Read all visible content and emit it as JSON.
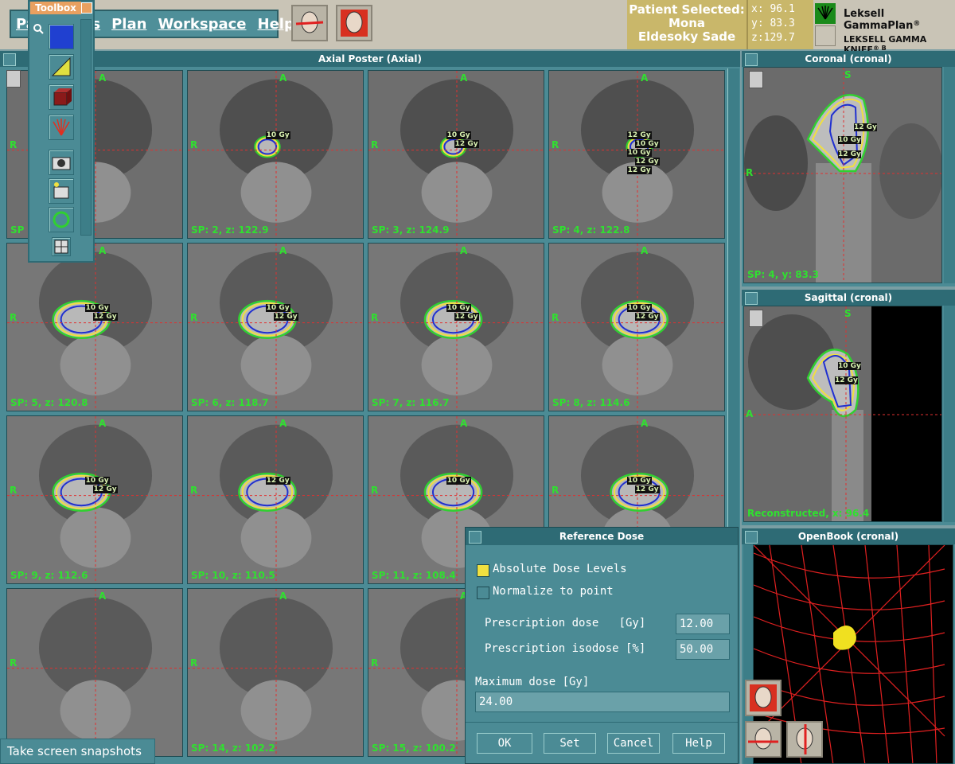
{
  "menu": {
    "items": [
      "Pa",
      "ols",
      "Plan",
      "Workspace",
      "Help"
    ]
  },
  "toolbox": {
    "title": "Toolbox"
  },
  "patient": {
    "label": "Patient Selected:",
    "name1": "Mona",
    "name2": "Eldesoky Sade"
  },
  "coords": {
    "x": "x:  96.1",
    "y": "y:  83.3",
    "z": "z:129.7"
  },
  "brand": {
    "line1": "Leksell GammaPlan",
    "line1_mark": "®",
    "line2": "LEKSELL GAMMA KNIFE",
    "line2_mark": "® B"
  },
  "axial": {
    "title": "Axial Poster (Axial)",
    "orient_a": "A",
    "orient_r": "R",
    "slices": [
      {
        "label": "SP",
        "doses": []
      },
      {
        "label": "SP: 2, z: 122.9",
        "doses": [
          "10 Gy"
        ]
      },
      {
        "label": "SP: 3, z: 124.9",
        "doses": [
          "10 Gy",
          "12 Gy"
        ]
      },
      {
        "label": "SP: 4, z: 122.8",
        "doses": [
          "12 Gy",
          "10 Gy",
          "10 Gy",
          "12 Gy",
          "12 Gy"
        ]
      },
      {
        "label": "SP: 5, z: 120.8",
        "doses": [
          "10 Gy",
          "12 Gy"
        ]
      },
      {
        "label": "SP: 6, z: 118.7",
        "doses": [
          "10 Gy",
          "12 Gy"
        ]
      },
      {
        "label": "SP: 7, z: 116.7",
        "doses": [
          "10 Gy",
          "12 Gy"
        ]
      },
      {
        "label": "SP: 8, z: 114.6",
        "doses": [
          "10 Gy",
          "12 Gy"
        ]
      },
      {
        "label": "SP: 9, z: 112.6",
        "doses": [
          "10 Gy",
          "12 Gy"
        ]
      },
      {
        "label": "SP: 10, z: 110.5",
        "doses": [
          "12 Gy"
        ]
      },
      {
        "label": "SP: 11, z: 108.4",
        "doses": [
          "10 Gy"
        ]
      },
      {
        "label": "",
        "doses": [
          "10 Gy",
          "12 Gy"
        ]
      },
      {
        "label": "",
        "doses": []
      },
      {
        "label": "SP: 14, z: 102.2",
        "doses": []
      },
      {
        "label": "SP: 15, z: 100.2",
        "doses": []
      },
      {
        "label": "",
        "doses": []
      }
    ]
  },
  "coronal": {
    "title": "Coronal (cronal)",
    "orient_s": "S",
    "orient_r": "R",
    "label": "SP: 4, y: 83.3",
    "doses": [
      "12 Gy",
      "10 Gy",
      "12 Gy"
    ]
  },
  "sagittal": {
    "title": "Sagittal (cronal)",
    "orient_s": "S",
    "orient_a": "A",
    "label": "Reconstructed, x: 96.4",
    "doses": [
      "10 Gy",
      "12 Gy"
    ]
  },
  "openbook": {
    "title": "OpenBook (cronal)"
  },
  "dialog": {
    "title": "Reference Dose",
    "absolute_label": "Absolute Dose Levels",
    "absolute_checked": true,
    "normalize_label": "Normalize to point",
    "normalize_checked": false,
    "presc_dose_label": "Prescription dose   [Gy]",
    "presc_dose_value": "12.00",
    "presc_iso_label": "Prescription isodose [%]",
    "presc_iso_value": "50.00",
    "max_label": "Maximum dose [Gy]",
    "max_value": "24.00",
    "ok": "OK",
    "set": "Set",
    "cancel": "Cancel",
    "help": "Help"
  },
  "snapshot": {
    "label": "Take screen snapshots"
  },
  "colors": {
    "contour_green": "#30d030",
    "contour_yellow": "#f0e040",
    "contour_blue": "#2030d0",
    "crosshair": "#e03030"
  }
}
